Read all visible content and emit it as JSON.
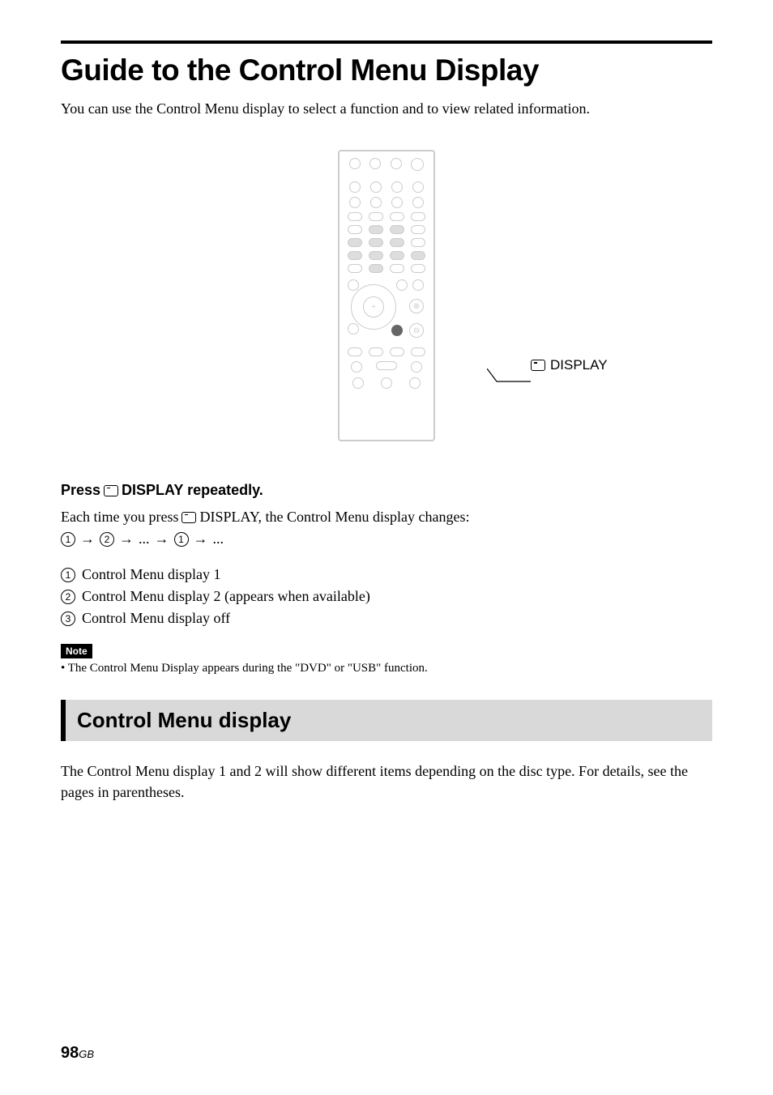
{
  "title": "Guide to the Control Menu Display",
  "intro": "You can use the Control Menu display to select a function and to view related information.",
  "callout": "DISPLAY",
  "instruction_prefix": "Press ",
  "instruction_suffix": " DISPLAY repeatedly.",
  "cycle_text_prefix": "Each time you press ",
  "cycle_text_suffix": " DISPLAY, the Control Menu display changes:",
  "sequence_dots": "...",
  "list": {
    "item1": "Control Menu display 1",
    "item2": "Control Menu display 2 (appears when available)",
    "item3": "Control Menu display off"
  },
  "note_label": "Note",
  "note_text": "• The Control Menu Display appears during the \"DVD\" or \"USB\" function.",
  "section_header": "Control Menu display",
  "section_text": "The Control Menu display 1 and 2 will show different items depending on the disc type. For details, see the pages in parentheses.",
  "page_number": "98",
  "page_suffix": "GB"
}
